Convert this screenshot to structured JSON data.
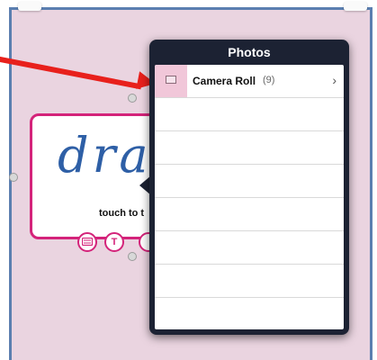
{
  "popover": {
    "title": "Photos",
    "albums": [
      {
        "name": "Camera Roll",
        "count": "(9)",
        "chevron": "›",
        "icon": "photo-thumbnail-icon"
      }
    ]
  },
  "card": {
    "handwriting": "dra",
    "hint": "touch to t"
  },
  "tools": [
    {
      "icon": "keyboard-icon"
    },
    {
      "icon": "text-tool-icon",
      "glyph": "T"
    },
    {
      "icon": "pen-tool-icon"
    }
  ],
  "colors": {
    "accent_pink": "#d4237a",
    "frame_blue": "#5b7fb0",
    "annotation_red": "#e8201c",
    "popover_dark": "#1c2233",
    "canvas_bg": "#ead4e0"
  }
}
